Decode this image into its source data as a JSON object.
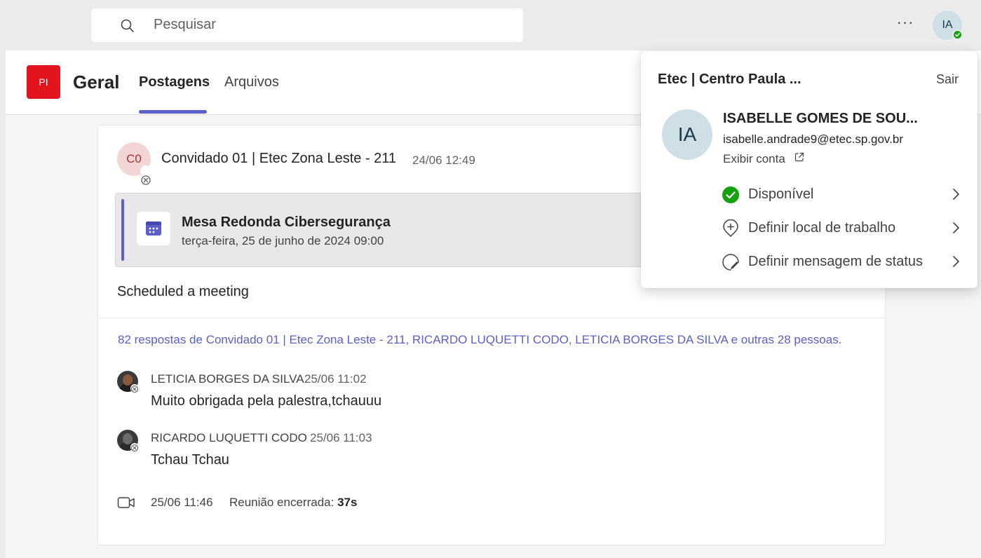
{
  "search": {
    "placeholder": "Pesquisar"
  },
  "topbar": {
    "more_label": "···",
    "avatar_initials": "IA"
  },
  "channel": {
    "team_tile": "PI",
    "name": "Geral",
    "tabs": [
      {
        "label": "Postagens"
      },
      {
        "label": "Arquivos"
      }
    ]
  },
  "post": {
    "avatar_initials": "C0",
    "author": "Convidado 01 | Etec Zona Leste - 211",
    "time": "24/06 12:49",
    "meeting": {
      "title": "Mesa Redonda Cibersegurança",
      "date": "terça-feira, 25 de junho de 2024 09:00"
    },
    "message": "Scheduled a meeting",
    "replies_summary": "82 respostas de Convidado 01 | Etec Zona Leste - 211, RICARDO LUQUETTI CODO, LETICIA BORGES DA SILVA e outras 28 pessoas.",
    "replies": [
      {
        "name": "LETICIA BORGES DA SILVA",
        "time": "25/06 11:02",
        "text": "Muito obrigada pela palestra,tchauuu"
      },
      {
        "name": "RICARDO LUQUETTI CODO",
        "time": "25/06 11:03",
        "text": "Tchau Tchau"
      }
    ],
    "meeting_end": {
      "time": "25/06 11:46",
      "label": "Reunião encerrada:",
      "duration": "37s"
    }
  },
  "profile": {
    "org": "Etec | Centro Paula ...",
    "sign_out": "Sair",
    "initials": "IA",
    "name": "ISABELLE GOMES DE SOU...",
    "email": "isabelle.andrade9@etec.sp.gov.br",
    "view_account": "Exibir conta",
    "items": [
      {
        "label": "Disponível",
        "icon": "available-status-icon"
      },
      {
        "label": "Definir local de trabalho",
        "icon": "location-add-icon"
      },
      {
        "label": "Definir mensagem de status",
        "icon": "status-message-icon"
      }
    ]
  },
  "colors": {
    "accent": "#5b5fc7",
    "team_tile": "#e3141d",
    "available": "#13a10e"
  }
}
